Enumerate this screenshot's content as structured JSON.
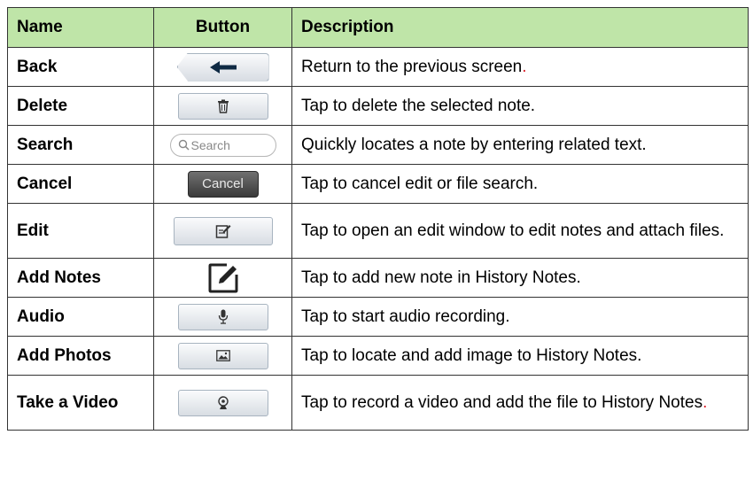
{
  "headers": {
    "name": "Name",
    "button": "Button",
    "description": "Description"
  },
  "rows": [
    {
      "name": "Back",
      "icon": "back-arrow-icon",
      "desc": "Return to the previous screen",
      "suffix": "."
    },
    {
      "name": "Delete",
      "icon": "trash-icon",
      "desc": "Tap to delete the selected note.",
      "suffix": ""
    },
    {
      "name": "Search",
      "icon": "search-field-icon",
      "button_text": "Search",
      "desc": "Quickly locates a note by entering related text.",
      "suffix": ""
    },
    {
      "name": "Cancel",
      "icon": "cancel-button-icon",
      "button_text": "Cancel",
      "desc": "Tap to cancel edit or file search.",
      "suffix": ""
    },
    {
      "name": "Edit",
      "icon": "edit-note-icon",
      "desc": "Tap to open an edit window to edit notes and attach files.",
      "suffix": ""
    },
    {
      "name": "Add Notes",
      "icon": "add-note-pencil-icon",
      "desc": "Tap to add new note in History Notes.",
      "suffix": ""
    },
    {
      "name": "Audio",
      "icon": "microphone-icon",
      "desc": "Tap to start audio recording.",
      "suffix": ""
    },
    {
      "name": "Add Photos",
      "icon": "image-icon",
      "desc": "Tap to locate and add image to History Notes.",
      "suffix": ""
    },
    {
      "name": "Take a Video",
      "icon": "webcam-icon",
      "desc": "Tap to record a video and add the file to History Notes",
      "suffix": "."
    }
  ]
}
